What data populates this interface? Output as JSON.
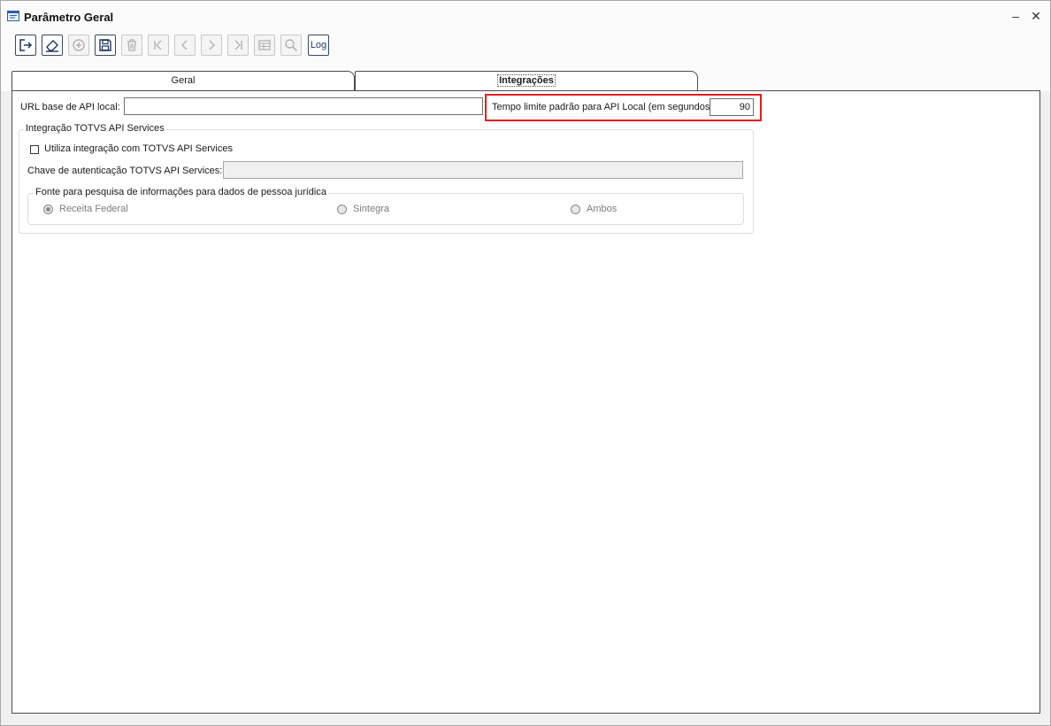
{
  "window": {
    "title": "Parâmetro Geral",
    "minimize_glyph": "–",
    "close_glyph": "✕"
  },
  "toolbar": {
    "buttons": [
      {
        "icon": "exit-icon",
        "enabled": true
      },
      {
        "icon": "eraser-icon",
        "enabled": true
      },
      {
        "icon": "add-circle-icon",
        "enabled": false
      },
      {
        "icon": "save-icon",
        "enabled": true
      },
      {
        "icon": "trash-icon",
        "enabled": false
      },
      {
        "icon": "first-record-icon",
        "enabled": false
      },
      {
        "icon": "previous-record-icon",
        "enabled": false
      },
      {
        "icon": "next-record-icon",
        "enabled": false
      },
      {
        "icon": "last-record-icon",
        "enabled": false
      },
      {
        "icon": "table-icon",
        "enabled": false
      },
      {
        "icon": "search-icon",
        "enabled": false
      }
    ],
    "log_label": "Log"
  },
  "tabs": [
    {
      "label": "Geral",
      "active": false
    },
    {
      "label": "Integrações",
      "active": true
    }
  ],
  "form": {
    "url_label": "URL base de API local:",
    "url_value": "",
    "timeout_label": "Tempo limite padrão para API Local (em segundos):",
    "timeout_value": "90",
    "totvs_group": {
      "legend": "Integração TOTVS API Services",
      "checkbox_label": "Utiliza integração com TOTVS API Services",
      "checkbox_checked": false,
      "key_label": "Chave de autenticação TOTVS API Services:",
      "key_value": "",
      "source_group": {
        "legend": "Fonte para pesquisa de informações para dados de pessoa jurídica",
        "options": [
          {
            "label": "Receita Federal",
            "selected": true
          },
          {
            "label": "Sintegra",
            "selected": false
          },
          {
            "label": "Ambos",
            "selected": false
          }
        ]
      }
    }
  },
  "colors": {
    "highlight": "#e02020",
    "toolbar_enabled_border": "#34495e"
  }
}
